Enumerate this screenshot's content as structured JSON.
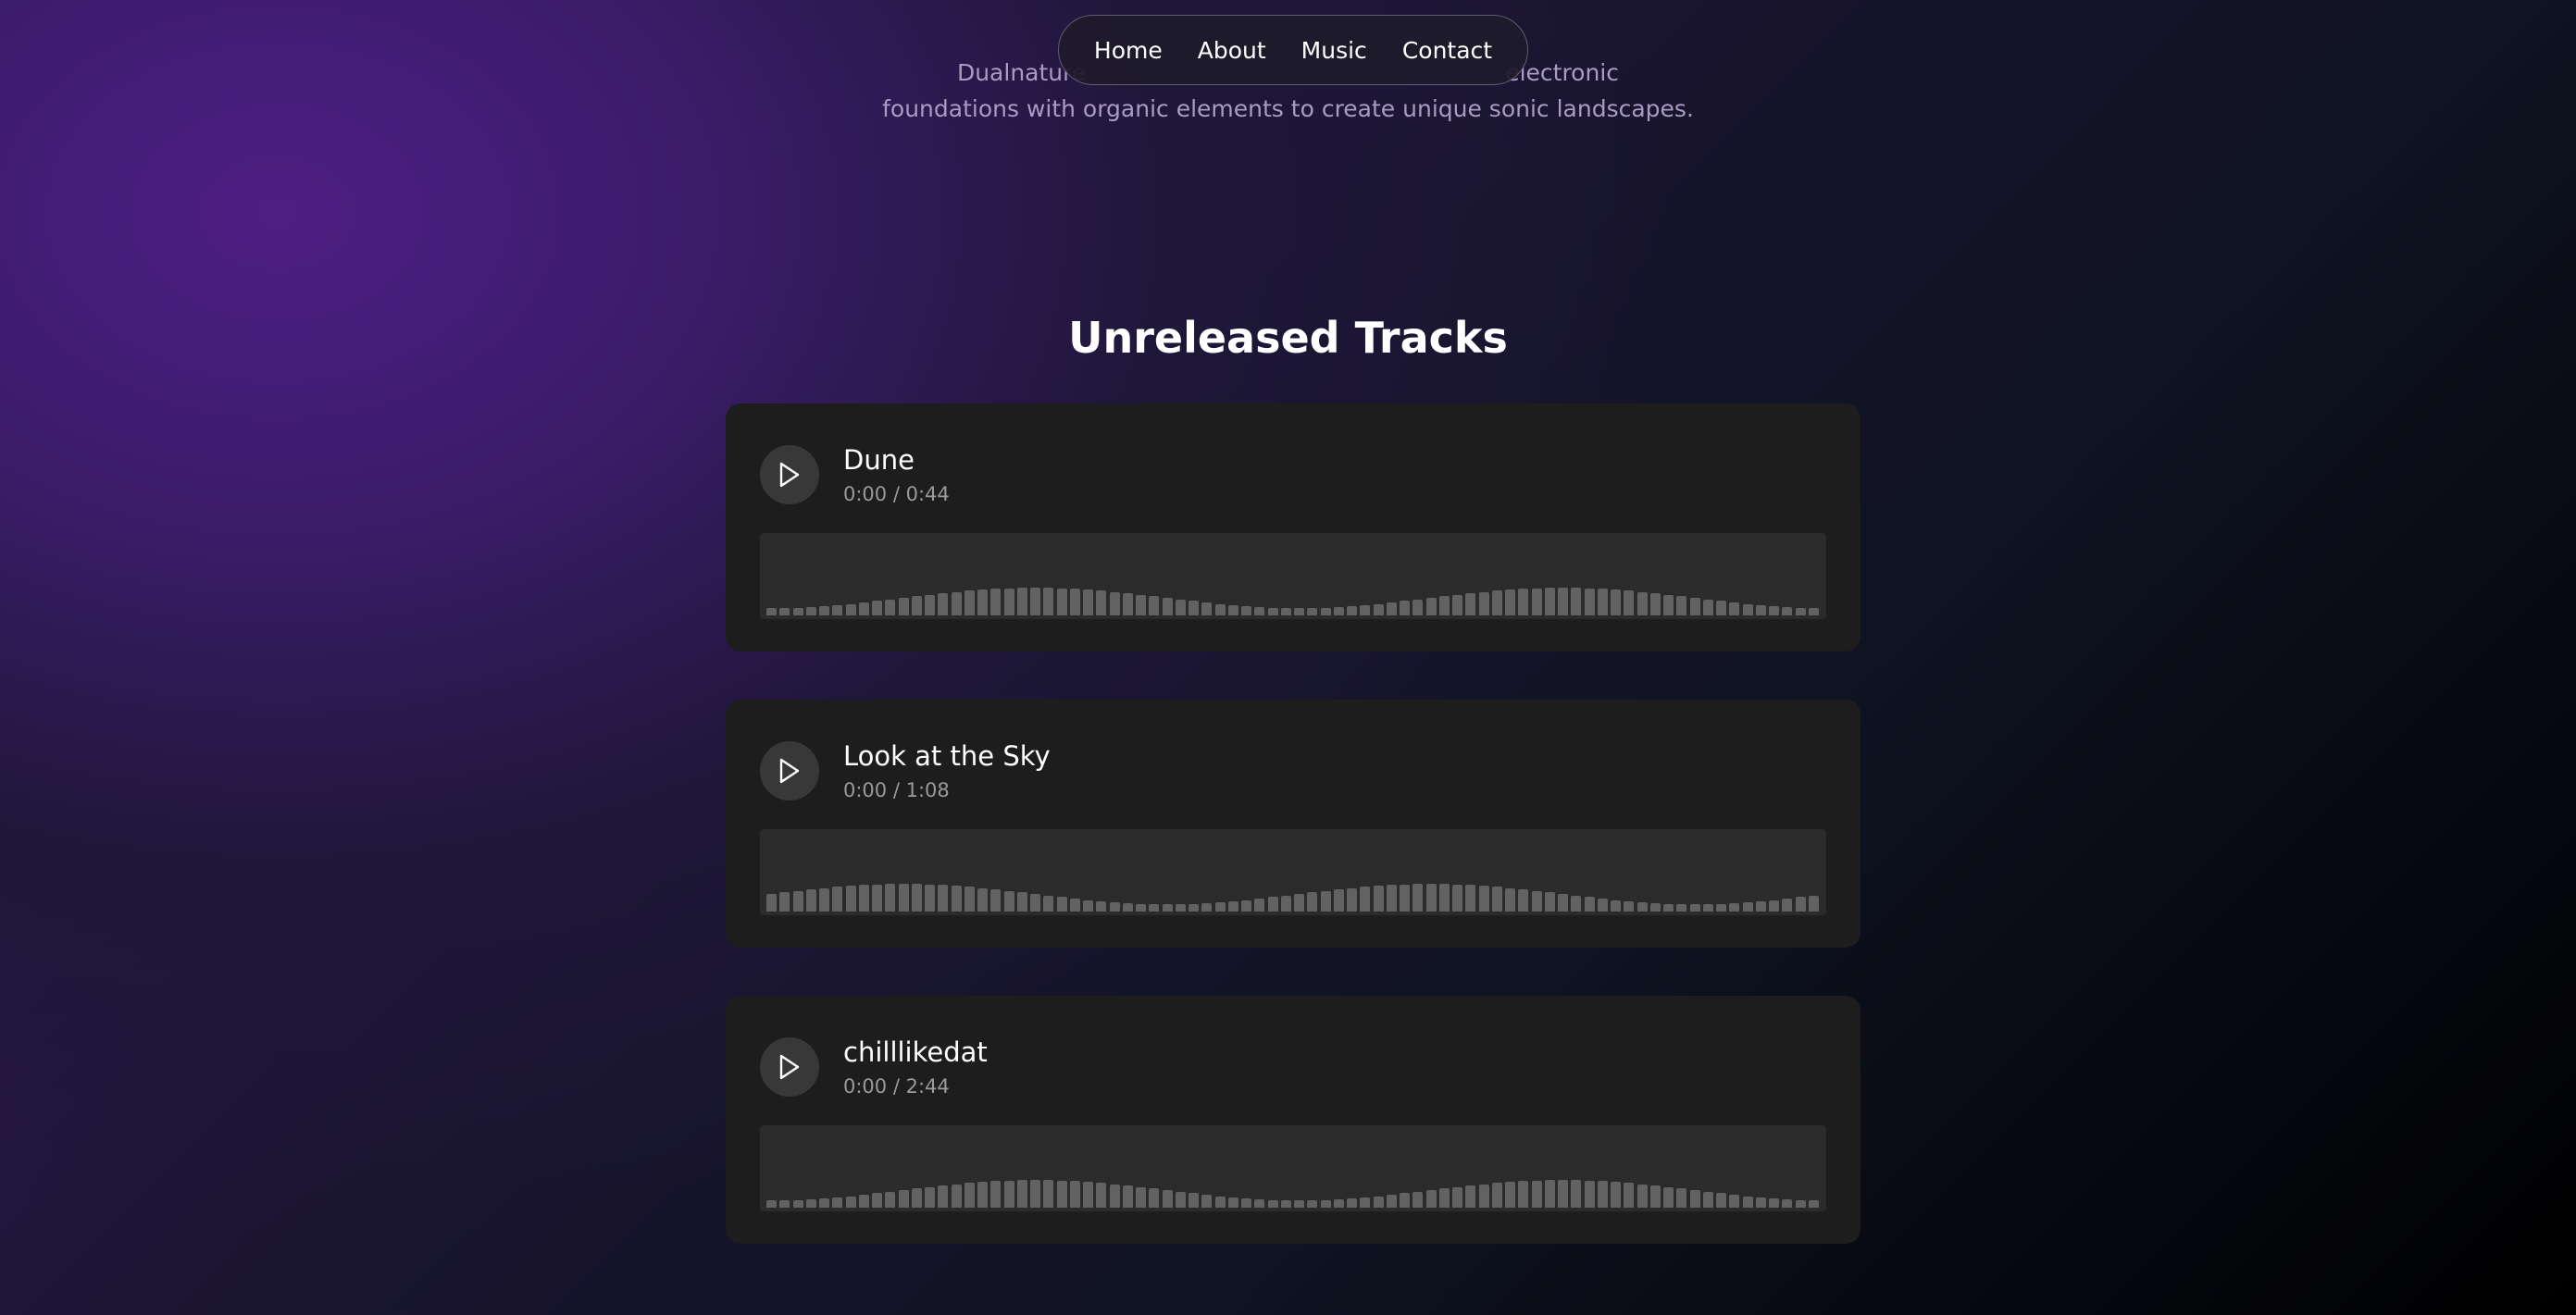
{
  "intro": {
    "line1": "Dualnature                                                         electronic",
    "line2": "foundations with organic elements to create unique sonic landscapes."
  },
  "nav": {
    "items": [
      {
        "label": "Home"
      },
      {
        "label": "About"
      },
      {
        "label": "Music"
      },
      {
        "label": "Contact"
      }
    ]
  },
  "section": {
    "title": "Unreleased Tracks"
  },
  "tracks": [
    {
      "title": "Dune",
      "time": "0:00 / 0:44",
      "progress": 0,
      "wave_phase": 0.0
    },
    {
      "title": "Look at the Sky",
      "time": "0:00 / 1:08",
      "progress": 0,
      "wave_phase": 0.25
    },
    {
      "title": "chilllikedat",
      "time": "0:00 / 2:44",
      "progress": 0,
      "wave_phase": 0.0
    }
  ],
  "colors": {
    "background_accent": "#4e1e84",
    "card": "#1d1d1d",
    "waveform_bar": "#626262"
  }
}
